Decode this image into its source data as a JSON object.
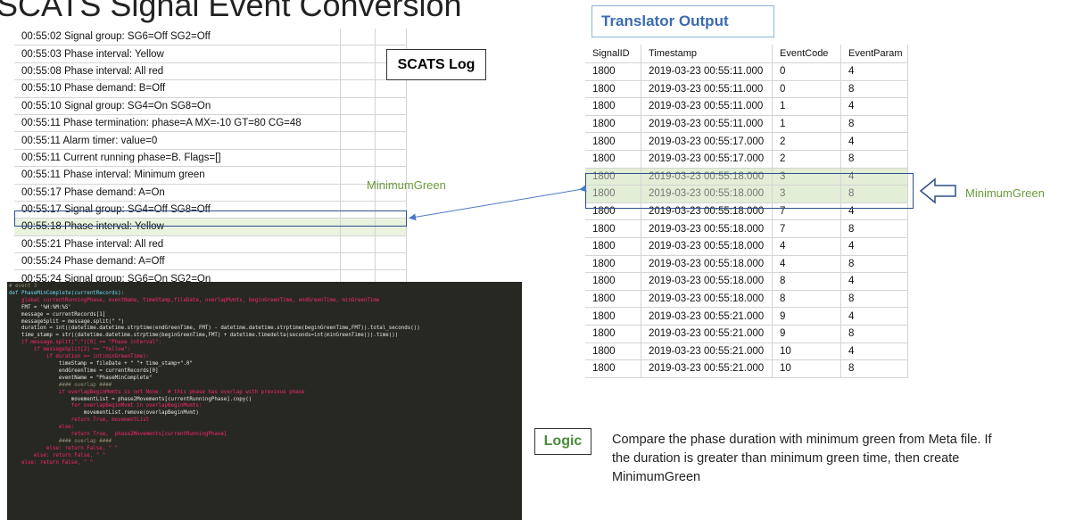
{
  "slide_title": "SCATS Signal Event Conversion",
  "scats_label": "SCATS Log",
  "scats_log": [
    "00:55:02 Signal group: SG6=Off SG2=Off",
    "00:55:03 Phase interval: Yellow",
    "00:55:08 Phase interval: All red",
    "00:55:10 Phase demand: B=Off",
    "00:55:10 Signal group: SG4=On SG8=On",
    "00:55:11 Phase termination: phase=A MX=-10 GT=80 CG=48",
    "00:55:11 Alarm timer: value=0",
    "00:55:11 Current running phase=B. Flags=[]",
    "00:55:11 Phase interval: Minimum green",
    "00:55:17 Phase demand: A=On",
    "00:55:17 Signal group: SG4=Off SG8=Off",
    "00:55:18 Phase interval: Yellow",
    "00:55:21 Phase interval: All red",
    "00:55:24 Phase demand: A=Off",
    "00:55:24 Signal group: SG6=On SG2=On"
  ],
  "event_label": "MinimumGreen",
  "translator_label": "Translator Output",
  "output_columns": [
    "SignalID",
    "Timestamp",
    "EventCode",
    "EventParam"
  ],
  "output_rows": [
    [
      "1800",
      "2019-03-23 00:55:11.000",
      "0",
      "4"
    ],
    [
      "1800",
      "2019-03-23 00:55:11.000",
      "0",
      "8"
    ],
    [
      "1800",
      "2019-03-23 00:55:11.000",
      "1",
      "4"
    ],
    [
      "1800",
      "2019-03-23 00:55:11.000",
      "1",
      "8"
    ],
    [
      "1800",
      "2019-03-23 00:55:17.000",
      "2",
      "4"
    ],
    [
      "1800",
      "2019-03-23 00:55:17.000",
      "2",
      "8"
    ],
    [
      "1800",
      "2019-03-23 00:55:18.000",
      "3",
      "4"
    ],
    [
      "1800",
      "2019-03-23 00:55:18.000",
      "3",
      "8"
    ],
    [
      "1800",
      "2019-03-23 00:55:18.000",
      "7",
      "4"
    ],
    [
      "1800",
      "2019-03-23 00:55:18.000",
      "7",
      "8"
    ],
    [
      "1800",
      "2019-03-23 00:55:18.000",
      "4",
      "4"
    ],
    [
      "1800",
      "2019-03-23 00:55:18.000",
      "4",
      "8"
    ],
    [
      "1800",
      "2019-03-23 00:55:18.000",
      "8",
      "4"
    ],
    [
      "1800",
      "2019-03-23 00:55:18.000",
      "8",
      "8"
    ],
    [
      "1800",
      "2019-03-23 00:55:21.000",
      "9",
      "4"
    ],
    [
      "1800",
      "2019-03-23 00:55:21.000",
      "9",
      "8"
    ],
    [
      "1800",
      "2019-03-23 00:55:21.000",
      "10",
      "4"
    ],
    [
      "1800",
      "2019-03-23 00:55:21.000",
      "10",
      "8"
    ]
  ],
  "logic_label": "Logic",
  "logic_text": "Compare the phase duration with minimum green from Meta file. If the duration is greater than minimum green time, then create MinimumGreen",
  "code_lines": [
    "# event 3",
    "def PhaseMinComplete(currentRecords):",
    "    global currentRunningPhase, eventName, timeStamp,fileDate, overlapMvmts, beginGreenTime, endGreenTime, minGreenTime",
    "    FMT = '%H:%M:%S'",
    "    message = currentRecords[1]",
    "    messageSplit = message.split(\" \")",
    "    duration = int((datetime.datetime.strptime(endGreenTime, FMT) - datetime.datetime.strptime(beginGreenTime,FMT)).total_seconds())",
    "    time_stamp = str((datetime.datetime.strptime(beginGreenTime,FMT) + datetime.timedelta(seconds=int(minGreenTime))).time())",
    "",
    "    if message.split(\":\")[0] == \"Phase interval\":",
    "        if messageSplit[2] == \"Yellow\":",
    "            if duration >= int(minGreenTime):",
    "                timeStamp = fileDate + \" \"+ time_stamp+\".0\"",
    "                endGreenTime = currentRecords[0]",
    "                eventName = \"PhaseMinComplete\"",
    "",
    "                #### overlap ####",
    "                if overlapBeginMvmts is not None:  # this phase has overlap with previous phase",
    "                    movementList = phase2Movements[currentRunningPhase].copy()",
    "                    for overlapBeginMvmt in overlapBeginMvmts:",
    "                        movementList.remove(overlapBeginMvmt)",
    "                    return True, movementList",
    "                else:",
    "                    return True,  phase2Movements[currentRunningPhase]",
    "                #### overlap ####",
    "",
    "            else: return False, \" \"",
    "        else: return False, \" \"",
    "    else: return False, \" \""
  ],
  "colors": {
    "highlight_fill": "#e2eed6",
    "highlight_border": "#2e4e8a",
    "event_label": "#6a9a3c",
    "translator_label": "#3b6bb0",
    "code_bg": "#272822"
  }
}
